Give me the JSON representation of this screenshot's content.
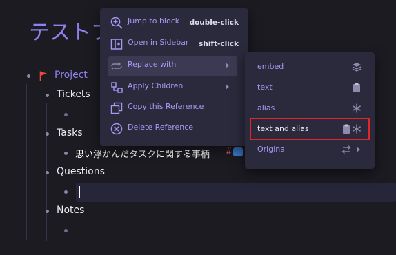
{
  "page": {
    "title": "テストプ"
  },
  "outline": {
    "project": "Project",
    "tickets": "Tickets",
    "tasks": "Tasks",
    "task_item": "思い浮かんだタスクに関する事柄",
    "task_tag_hash": "#",
    "questions": "Questions",
    "notes": "Notes"
  },
  "context_menu": {
    "items": [
      {
        "label": "Jump to block",
        "shortcut": "double-click",
        "icon": "zoom-in-icon"
      },
      {
        "label": "Open in Sidebar",
        "shortcut": "shift-click",
        "icon": "sidebar-icon"
      },
      {
        "label": "Replace with",
        "icon": "replace-icon"
      },
      {
        "label": "Apply Children",
        "icon": "apply-children-icon"
      },
      {
        "label": "Copy this Reference",
        "icon": "copy-icon"
      },
      {
        "label": "Delete Reference",
        "icon": "delete-circle-icon"
      }
    ]
  },
  "submenu": {
    "items": [
      {
        "label": "embed",
        "icon": "layers-icon"
      },
      {
        "label": "text",
        "icon": "clipboard-icon"
      },
      {
        "label": "alias",
        "icon": "asterisk-icon"
      },
      {
        "label": "text and alias",
        "icon": "clipboard-asterisk-icon"
      },
      {
        "label": "Original",
        "icon": "swap-arrows-icon"
      }
    ]
  },
  "colors": {
    "accent": "#8e83ee",
    "menu_bg": "#2b2a3c",
    "highlight_border": "#e0262b"
  }
}
